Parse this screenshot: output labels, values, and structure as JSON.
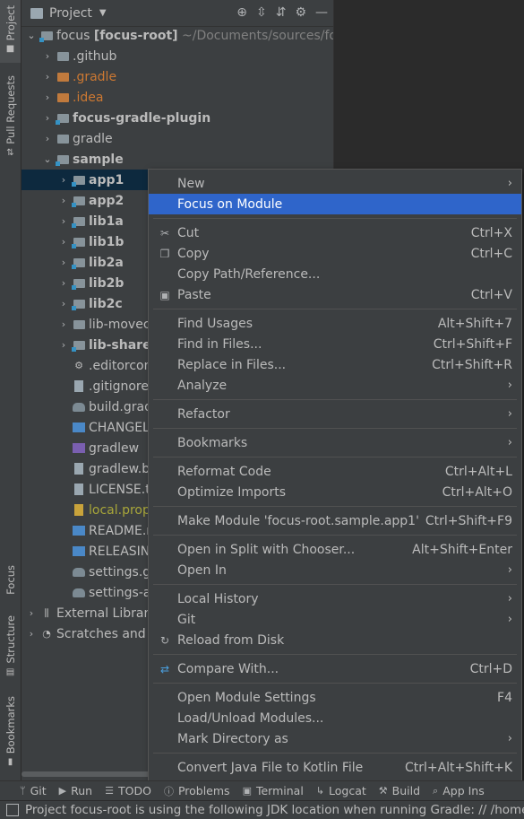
{
  "side_tabs": {
    "project": "Project",
    "pull_requests": "Pull Requests",
    "focus": "Focus",
    "structure": "Structure",
    "bookmarks": "Bookmarks"
  },
  "toolbar": {
    "title": "Project"
  },
  "tree": {
    "root_name": "focus",
    "root_module": "[focus-root]",
    "root_path": "~/Documents/sources/focu",
    "items": [
      {
        "label": ".github"
      },
      {
        "label": ".gradle"
      },
      {
        "label": ".idea"
      },
      {
        "label": "focus-gradle-plugin"
      },
      {
        "label": "gradle"
      },
      {
        "label": "sample"
      },
      {
        "label": "app1"
      },
      {
        "label": "app2"
      },
      {
        "label": "lib1a"
      },
      {
        "label": "lib1b"
      },
      {
        "label": "lib2a"
      },
      {
        "label": "lib2b"
      },
      {
        "label": "lib2c"
      },
      {
        "label": "lib-movec"
      },
      {
        "label": "lib-share"
      },
      {
        "label": ".editorconfig"
      },
      {
        "label": ".gitignore"
      },
      {
        "label": "build.gradle"
      },
      {
        "label": "CHANGELOG"
      },
      {
        "label": "gradlew"
      },
      {
        "label": "gradlew.bat"
      },
      {
        "label": "LICENSE.txt"
      },
      {
        "label": "local.propert"
      },
      {
        "label": "README.mc"
      },
      {
        "label": "RELEASING."
      },
      {
        "label": "settings.grac"
      },
      {
        "label": "settings-all.c"
      },
      {
        "label": "External Librari"
      },
      {
        "label": "Scratches and C"
      }
    ]
  },
  "menu": {
    "new": "New",
    "focus_on_module": "Focus on Module",
    "cut": "Cut",
    "cut_sc": "Ctrl+X",
    "copy": "Copy",
    "copy_sc": "Ctrl+C",
    "copy_path": "Copy Path/Reference...",
    "paste": "Paste",
    "paste_sc": "Ctrl+V",
    "find_usages": "Find Usages",
    "find_usages_sc": "Alt+Shift+7",
    "find_in_files": "Find in Files...",
    "find_in_files_sc": "Ctrl+Shift+F",
    "replace_in_files": "Replace in Files...",
    "replace_in_files_sc": "Ctrl+Shift+R",
    "analyze": "Analyze",
    "refactor": "Refactor",
    "bookmarks": "Bookmarks",
    "reformat_code": "Reformat Code",
    "reformat_code_sc": "Ctrl+Alt+L",
    "optimize_imports": "Optimize Imports",
    "optimize_imports_sc": "Ctrl+Alt+O",
    "make_module": "Make Module 'focus-root.sample.app1'",
    "make_module_sc": "Ctrl+Shift+F9",
    "open_split": "Open in Split with Chooser...",
    "open_split_sc": "Alt+Shift+Enter",
    "open_in": "Open In",
    "local_history": "Local History",
    "git": "Git",
    "reload_from_disk": "Reload from Disk",
    "compare_with": "Compare With...",
    "compare_with_sc": "Ctrl+D",
    "open_module_settings": "Open Module Settings",
    "open_module_settings_sc": "F4",
    "load_unload_modules": "Load/Unload Modules...",
    "mark_directory_as": "Mark Directory as",
    "convert_java": "Convert Java File to Kotlin File",
    "convert_java_sc": "Ctrl+Alt+Shift+K"
  },
  "bottom_tabs": [
    "Git",
    "Run",
    "TODO",
    "Problems",
    "Terminal",
    "Logcat",
    "Build",
    "App Ins"
  ],
  "status": "Project focus-root is using the following JDK location when running Gradle: // /home/de"
}
